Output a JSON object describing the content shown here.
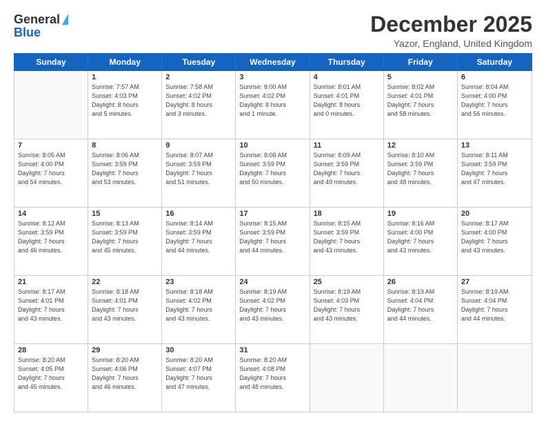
{
  "logo": {
    "line1": "General",
    "line2": "Blue"
  },
  "title": "December 2025",
  "location": "Yazor, England, United Kingdom",
  "days_of_week": [
    "Sunday",
    "Monday",
    "Tuesday",
    "Wednesday",
    "Thursday",
    "Friday",
    "Saturday"
  ],
  "weeks": [
    [
      {
        "day": "",
        "info": ""
      },
      {
        "day": "1",
        "info": "Sunrise: 7:57 AM\nSunset: 4:03 PM\nDaylight: 8 hours\nand 5 minutes."
      },
      {
        "day": "2",
        "info": "Sunrise: 7:58 AM\nSunset: 4:02 PM\nDaylight: 8 hours\nand 3 minutes."
      },
      {
        "day": "3",
        "info": "Sunrise: 8:00 AM\nSunset: 4:02 PM\nDaylight: 8 hours\nand 1 minute."
      },
      {
        "day": "4",
        "info": "Sunrise: 8:01 AM\nSunset: 4:01 PM\nDaylight: 8 hours\nand 0 minutes."
      },
      {
        "day": "5",
        "info": "Sunrise: 8:02 AM\nSunset: 4:01 PM\nDaylight: 7 hours\nand 58 minutes."
      },
      {
        "day": "6",
        "info": "Sunrise: 8:04 AM\nSunset: 4:00 PM\nDaylight: 7 hours\nand 56 minutes."
      }
    ],
    [
      {
        "day": "7",
        "info": "Sunrise: 8:05 AM\nSunset: 4:00 PM\nDaylight: 7 hours\nand 54 minutes."
      },
      {
        "day": "8",
        "info": "Sunrise: 8:06 AM\nSunset: 3:59 PM\nDaylight: 7 hours\nand 53 minutes."
      },
      {
        "day": "9",
        "info": "Sunrise: 8:07 AM\nSunset: 3:59 PM\nDaylight: 7 hours\nand 51 minutes."
      },
      {
        "day": "10",
        "info": "Sunrise: 8:08 AM\nSunset: 3:59 PM\nDaylight: 7 hours\nand 50 minutes."
      },
      {
        "day": "11",
        "info": "Sunrise: 8:09 AM\nSunset: 3:59 PM\nDaylight: 7 hours\nand 49 minutes."
      },
      {
        "day": "12",
        "info": "Sunrise: 8:10 AM\nSunset: 3:59 PM\nDaylight: 7 hours\nand 48 minutes."
      },
      {
        "day": "13",
        "info": "Sunrise: 8:11 AM\nSunset: 3:59 PM\nDaylight: 7 hours\nand 47 minutes."
      }
    ],
    [
      {
        "day": "14",
        "info": "Sunrise: 8:12 AM\nSunset: 3:59 PM\nDaylight: 7 hours\nand 46 minutes."
      },
      {
        "day": "15",
        "info": "Sunrise: 8:13 AM\nSunset: 3:59 PM\nDaylight: 7 hours\nand 45 minutes."
      },
      {
        "day": "16",
        "info": "Sunrise: 8:14 AM\nSunset: 3:59 PM\nDaylight: 7 hours\nand 44 minutes."
      },
      {
        "day": "17",
        "info": "Sunrise: 8:15 AM\nSunset: 3:59 PM\nDaylight: 7 hours\nand 44 minutes."
      },
      {
        "day": "18",
        "info": "Sunrise: 8:15 AM\nSunset: 3:59 PM\nDaylight: 7 hours\nand 43 minutes."
      },
      {
        "day": "19",
        "info": "Sunrise: 8:16 AM\nSunset: 4:00 PM\nDaylight: 7 hours\nand 43 minutes."
      },
      {
        "day": "20",
        "info": "Sunrise: 8:17 AM\nSunset: 4:00 PM\nDaylight: 7 hours\nand 43 minutes."
      }
    ],
    [
      {
        "day": "21",
        "info": "Sunrise: 8:17 AM\nSunset: 4:01 PM\nDaylight: 7 hours\nand 43 minutes."
      },
      {
        "day": "22",
        "info": "Sunrise: 8:18 AM\nSunset: 4:01 PM\nDaylight: 7 hours\nand 43 minutes."
      },
      {
        "day": "23",
        "info": "Sunrise: 8:18 AM\nSunset: 4:02 PM\nDaylight: 7 hours\nand 43 minutes."
      },
      {
        "day": "24",
        "info": "Sunrise: 8:19 AM\nSunset: 4:02 PM\nDaylight: 7 hours\nand 43 minutes."
      },
      {
        "day": "25",
        "info": "Sunrise: 8:19 AM\nSunset: 4:03 PM\nDaylight: 7 hours\nand 43 minutes."
      },
      {
        "day": "26",
        "info": "Sunrise: 8:19 AM\nSunset: 4:04 PM\nDaylight: 7 hours\nand 44 minutes."
      },
      {
        "day": "27",
        "info": "Sunrise: 8:19 AM\nSunset: 4:04 PM\nDaylight: 7 hours\nand 44 minutes."
      }
    ],
    [
      {
        "day": "28",
        "info": "Sunrise: 8:20 AM\nSunset: 4:05 PM\nDaylight: 7 hours\nand 45 minutes."
      },
      {
        "day": "29",
        "info": "Sunrise: 8:20 AM\nSunset: 4:06 PM\nDaylight: 7 hours\nand 46 minutes."
      },
      {
        "day": "30",
        "info": "Sunrise: 8:20 AM\nSunset: 4:07 PM\nDaylight: 7 hours\nand 47 minutes."
      },
      {
        "day": "31",
        "info": "Sunrise: 8:20 AM\nSunset: 4:08 PM\nDaylight: 7 hours\nand 48 minutes."
      },
      {
        "day": "",
        "info": ""
      },
      {
        "day": "",
        "info": ""
      },
      {
        "day": "",
        "info": ""
      }
    ]
  ]
}
